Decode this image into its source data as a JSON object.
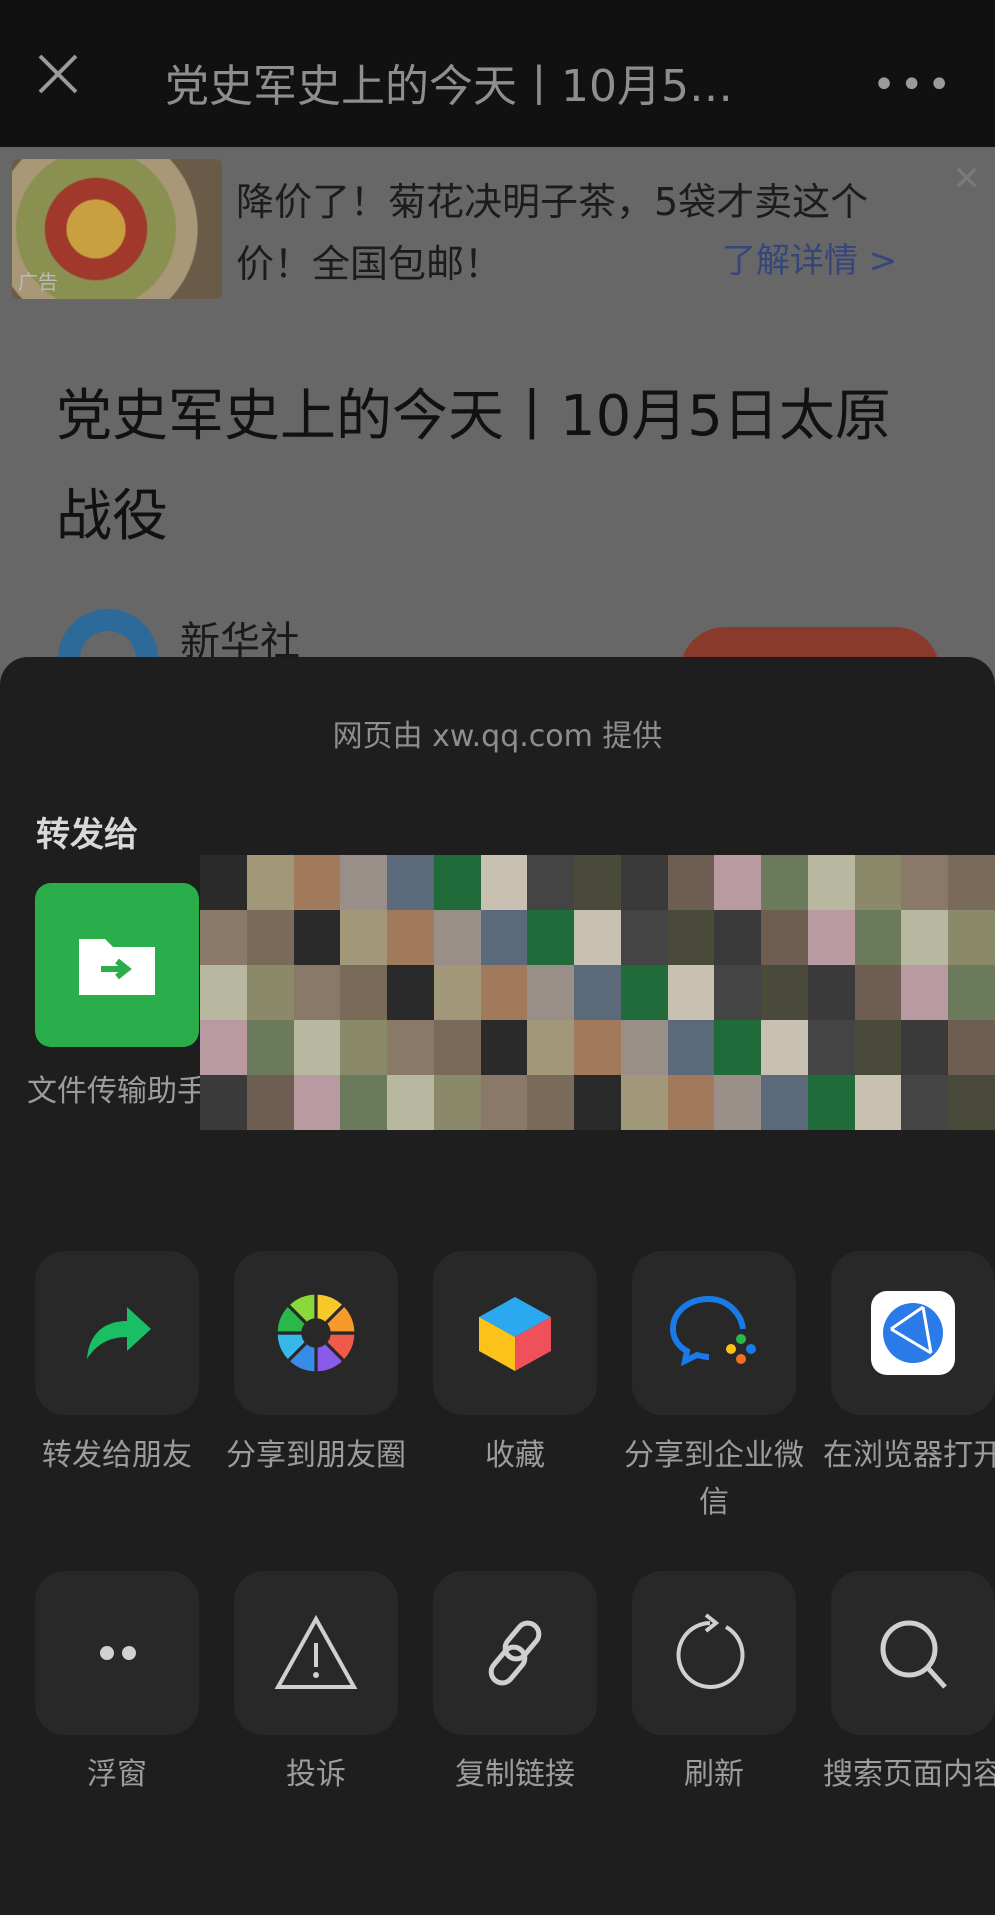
{
  "topbar": {
    "title": "党史军史上的今天丨10月5…",
    "close_icon": "close-icon",
    "more_icon": "more-icon",
    "more": "•••"
  },
  "page": {
    "ad": {
      "tag": "广告",
      "text": "降价了！菊花决明子茶，5袋才卖这个价！全国包邮！",
      "more": "了解详情 >"
    },
    "article_title": "党史军史上的今天丨10月5日太原战役",
    "author": "新华社"
  },
  "sheet": {
    "provider": "网页由 xw.qq.com 提供",
    "forward_to": "转发给",
    "contacts": [
      {
        "name": "文件传输助手",
        "icon": "file-transfer-icon",
        "color": "#2aae4c"
      }
    ],
    "actions_row1": [
      {
        "label": "转发给朋友",
        "icon": "forward-icon"
      },
      {
        "label": "分享到朋友圈",
        "icon": "moments-icon"
      },
      {
        "label": "收藏",
        "icon": "favorite-cube-icon"
      },
      {
        "label": "分享到企业微信",
        "icon": "wecom-icon"
      },
      {
        "label": "在浏览器打开",
        "icon": "browser-icon"
      }
    ],
    "actions_row2": [
      {
        "label": "浮窗",
        "icon": "float-window-icon"
      },
      {
        "label": "投诉",
        "icon": "warning-icon"
      },
      {
        "label": "复制链接",
        "icon": "link-icon"
      },
      {
        "label": "刷新",
        "icon": "refresh-icon"
      },
      {
        "label": "搜索页面内容",
        "icon": "search-icon"
      }
    ]
  }
}
